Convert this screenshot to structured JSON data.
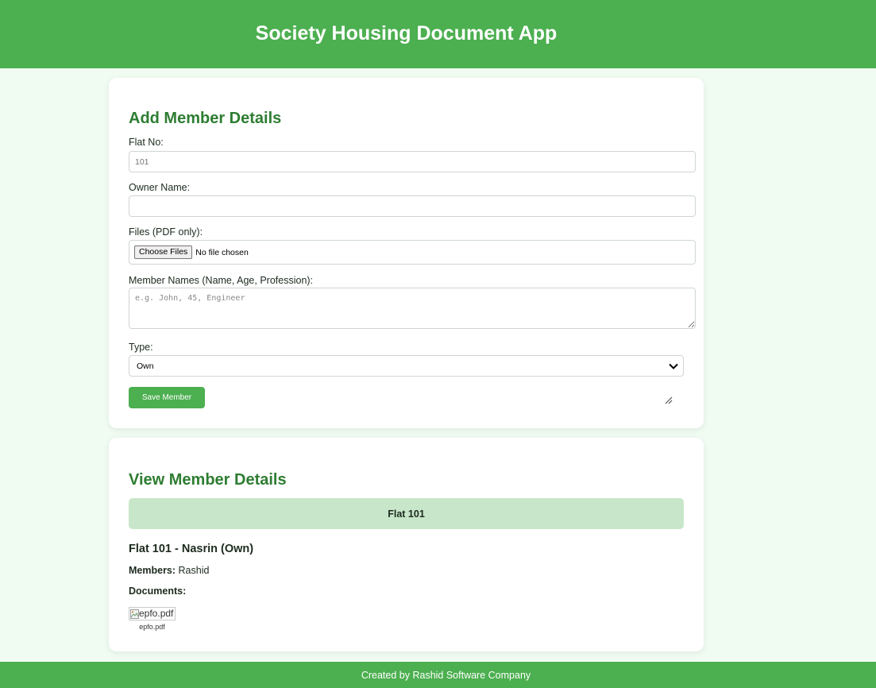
{
  "colors": {
    "brand": "#4caf50",
    "heading": "#2e7d32",
    "page_background": "#f0fcf2",
    "flat_tab": "#c8e6c9"
  },
  "header": {
    "title": "Society Housing Document App"
  },
  "add_form": {
    "title": "Add Member Details",
    "flat_no": {
      "label": "Flat No:",
      "placeholder": "101"
    },
    "owner_name": {
      "label": "Owner Name:",
      "value": ""
    },
    "files": {
      "label": "Files (PDF only):",
      "button_label": "Choose Files",
      "status": "No file chosen"
    },
    "member_names": {
      "label": "Member Names (Name, Age, Profession):",
      "placeholder": "e.g. John, 45, Engineer"
    },
    "type": {
      "label": "Type:",
      "selected": "Own"
    },
    "save_label": "Save Member"
  },
  "view": {
    "title": "View Member Details",
    "flat_tab": "Flat 101",
    "entry": {
      "title": "Flat 101 - Nasrin (Own)",
      "members_label": "Members:",
      "members_value": "Rashid",
      "documents_label": "Documents:",
      "documents": [
        {
          "alt": "epfo.pdf",
          "name": "epfo.pdf",
          "icon": "broken-image-icon"
        }
      ]
    }
  },
  "footer": {
    "text": "Created by Rashid Software Company"
  }
}
